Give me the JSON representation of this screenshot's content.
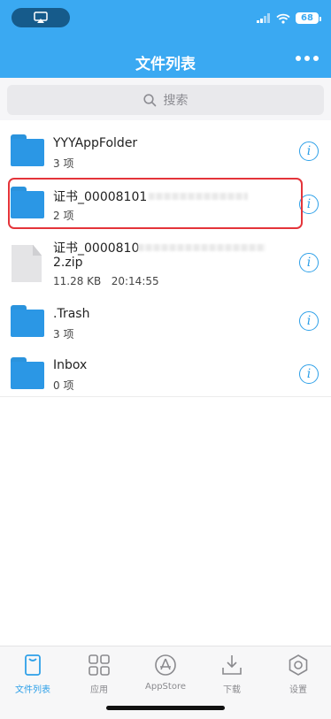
{
  "status_bar": {
    "battery": "68"
  },
  "nav": {
    "title": "文件列表"
  },
  "search": {
    "placeholder": "搜索"
  },
  "files": [
    {
      "name": "YYYAppFolder",
      "meta": "3 项",
      "type": "folder"
    },
    {
      "name": "证书_00008101",
      "meta": "2 项",
      "type": "folder",
      "highlighted": true
    },
    {
      "name_line1": "证书_0000810",
      "name_line2": "2.zip",
      "size": "11.28 KB",
      "time": "20:14:55",
      "type": "zip"
    },
    {
      "name": ".Trash",
      "meta": "3 项",
      "type": "folder"
    },
    {
      "name": "Inbox",
      "meta": "0 项",
      "type": "folder"
    }
  ],
  "tabs": [
    {
      "label": "文件列表",
      "icon": "file-list-icon",
      "active": true
    },
    {
      "label": "应用",
      "icon": "apps-grid-icon"
    },
    {
      "label": "AppStore",
      "icon": "appstore-icon"
    },
    {
      "label": "下载",
      "icon": "download-icon"
    },
    {
      "label": "设置",
      "icon": "settings-gear-icon"
    }
  ],
  "colors": {
    "header": "#3aa9f2",
    "accent": "#2ea0e8",
    "highlight_border": "#e4343a"
  }
}
